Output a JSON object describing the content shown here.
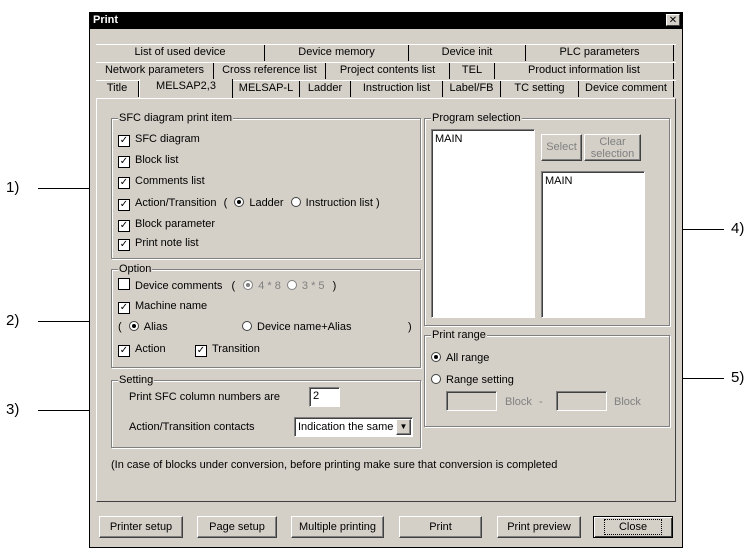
{
  "window": {
    "title": "Print",
    "close_glyph": "✕"
  },
  "tabs": {
    "row1": [
      "List of used device",
      "Device memory",
      "Device init",
      "PLC parameters"
    ],
    "row2": [
      "Network parameters",
      "Cross reference list",
      "Project contents list",
      "TEL",
      "Product information list"
    ],
    "row3": [
      "Title",
      "MELSAP2,3",
      "MELSAP-L",
      "Ladder",
      "Instruction list",
      "Label/FB",
      "TC setting",
      "Device comment"
    ],
    "active": "MELSAP2,3"
  },
  "sfc_group": {
    "legend": "SFC diagram print item",
    "items": [
      {
        "label": "SFC diagram",
        "checked": true
      },
      {
        "label": "Block list",
        "checked": true
      },
      {
        "label": "Comments list",
        "checked": true
      },
      {
        "label": "Action/Transition",
        "checked": true
      },
      {
        "label": "Block parameter",
        "checked": true
      },
      {
        "label": "Print note list",
        "checked": true
      }
    ],
    "paren_open": "(",
    "paren_close": ")",
    "radio_ladder": "Ladder",
    "radio_instruction": "Instruction list",
    "selected": "Ladder"
  },
  "option_group": {
    "legend": "Option",
    "device_comments": {
      "label": "Device comments",
      "checked": false
    },
    "size_a": "4 * 8",
    "size_b": "3 * 5",
    "machine_name": {
      "label": "Machine name",
      "checked": true
    },
    "radio_alias": "Alias",
    "radio_device_alias": "Device name+Alias",
    "paren_open": "(",
    "paren_close": ")",
    "action": {
      "label": "Action",
      "checked": true
    },
    "transition": {
      "label": "Transition",
      "checked": true
    }
  },
  "setting_group": {
    "legend": "Setting",
    "column_label": "Print SFC column numbers are",
    "column_value": "2",
    "contacts_label": "Action/Transition contacts",
    "contacts_value": "Indication the same"
  },
  "program_selection": {
    "legend": "Program selection",
    "left_items": [
      "MAIN"
    ],
    "right_items": [
      "MAIN"
    ],
    "select_button": "Select",
    "clear_button": "Clear selection"
  },
  "print_range": {
    "legend": "Print range",
    "all_range": "All range",
    "range_setting": "Range setting",
    "selected": "All range",
    "block_label": "Block",
    "dash": "-"
  },
  "note": "(In case of blocks under conversion, before printing make sure that conversion is completed",
  "buttons": {
    "printer_setup": "Printer setup",
    "page_setup": "Page setup",
    "multiple_printing": "Multiple printing",
    "print": "Print",
    "print_preview": "Print preview",
    "close": "Close"
  },
  "callouts": [
    "1)",
    "2)",
    "3)",
    "4)",
    "5)"
  ]
}
